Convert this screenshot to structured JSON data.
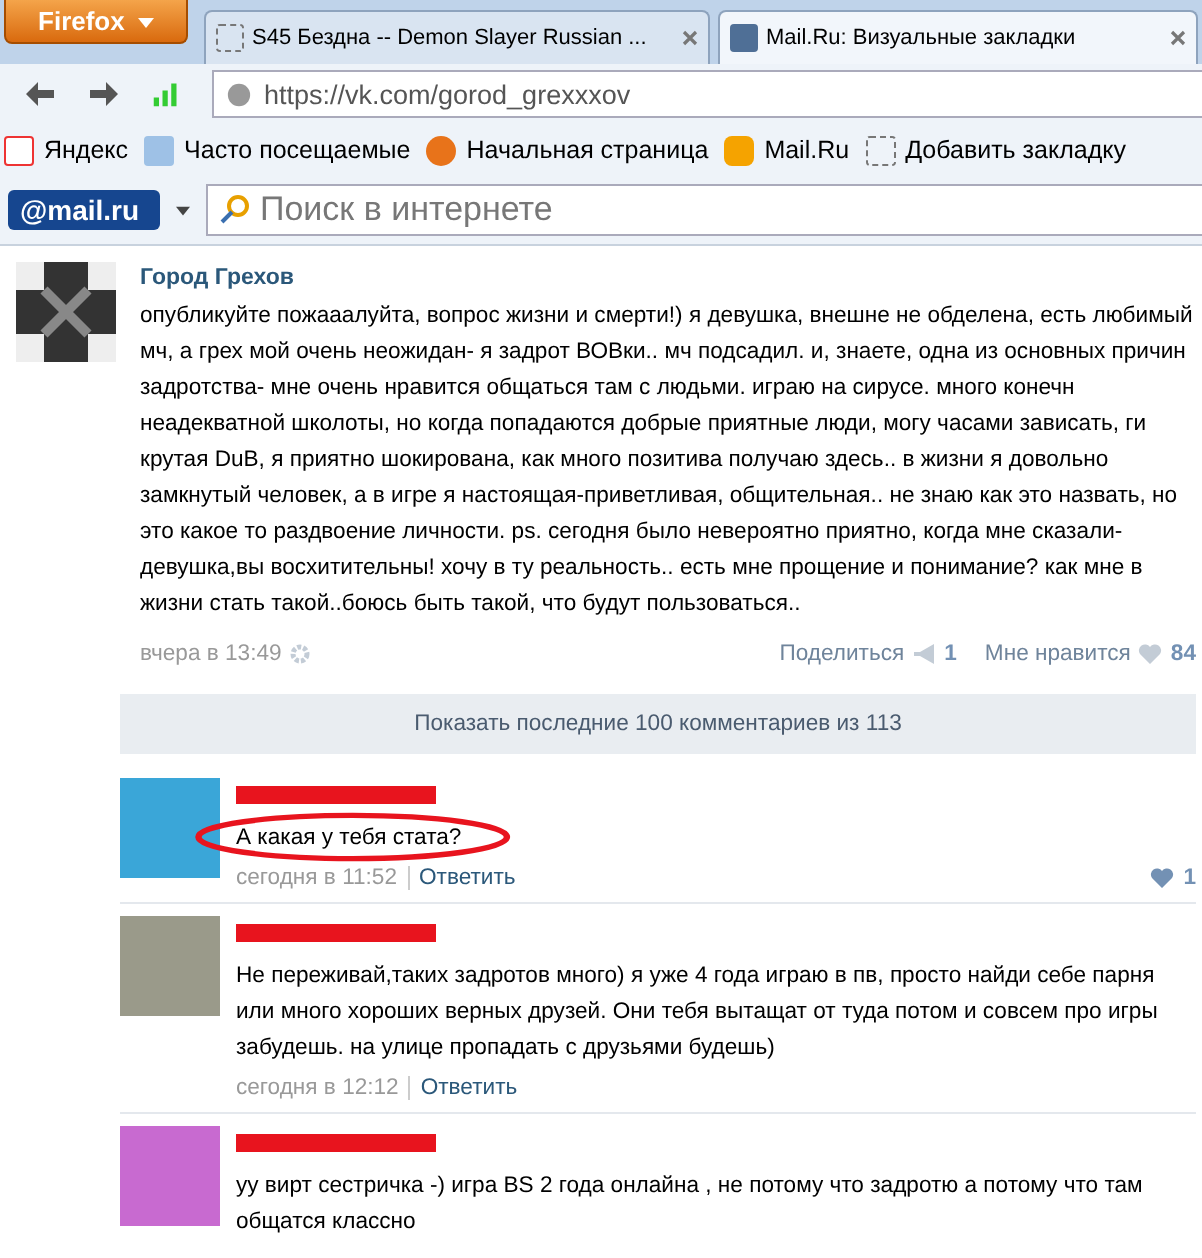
{
  "browser": {
    "menu_button": "Firefox",
    "tabs": [
      {
        "title": "S45 Бездна -- Demon Slayer Russian ...",
        "kind": "blank",
        "selected": false
      },
      {
        "title": "Mail.Ru: Визуальные закладки",
        "kind": "vk",
        "selected": true
      }
    ],
    "url": "https://vk.com/gorod_grexxxov",
    "bookmarks": [
      {
        "label": "Яндекс",
        "kind": "yandex"
      },
      {
        "label": "Часто посещаемые",
        "kind": "frequent"
      },
      {
        "label": "Начальная страница",
        "kind": "firefox"
      },
      {
        "label": "Mail.Ru",
        "kind": "mail"
      },
      {
        "label": "Добавить закладку",
        "kind": "blank"
      }
    ],
    "search_logo": "@mail.ru",
    "search_placeholder": "Поиск в интернете"
  },
  "post": {
    "author": "Город Грехов",
    "text": "опубликуйте пожааалуйта, вопрос жизни и смерти!) я девушка, внешне не обделена, есть любимый мч, а грех мой очень неожидан- я задрот ВОВки.. мч подсадил. и, знаете, одна из основных причин задротства- мне очень нравится общаться там с людьми. играю на сирусе. много конечн неадекватной школоты, но когда попадаются добрые приятные люди, могу часами зависать, ги крутая DuB, я приятно шокирована, как много позитива получаю здесь.. в жизни я довольно замкнутый человек, а в игре я настоящая-приветливая, общительная.. не знаю как это назвать, но это какое то раздвоение личности. ps. сегодня было невероятно приятно, когда мне сказали- девушка,вы восхитительны! хочу в ту реальность.. есть мне прощение и понимание? как мне в жизни стать такой..боюсь быть такой, что будут пользоваться..",
    "time": "вчера в 13:49",
    "share_label": "Поделиться",
    "share_count": "1",
    "like_label": "Мне нравится",
    "like_count": "84"
  },
  "show_more": "Показать последние 100 комментариев из 113",
  "comments": [
    {
      "text": "А какая у тебя стата?",
      "circled": true,
      "time": "сегодня в 11:52",
      "reply": "Ответить",
      "likes": "1"
    },
    {
      "text": "Не переживай,таких задротов много) я уже 4 года играю в пв, просто найди себе парня или много хороших верных друзей. Они тебя вытащат от туда потом и совсем про игры забудешь. на улице пропадать с друзьями будешь)",
      "circled": false,
      "time": "сегодня в 12:12",
      "reply": "Ответить"
    },
    {
      "text": "уу вирт сестричка -) игра BS 2 года онлайна , не потому что задротю а потому что там общатся классно",
      "circled": false
    }
  ]
}
